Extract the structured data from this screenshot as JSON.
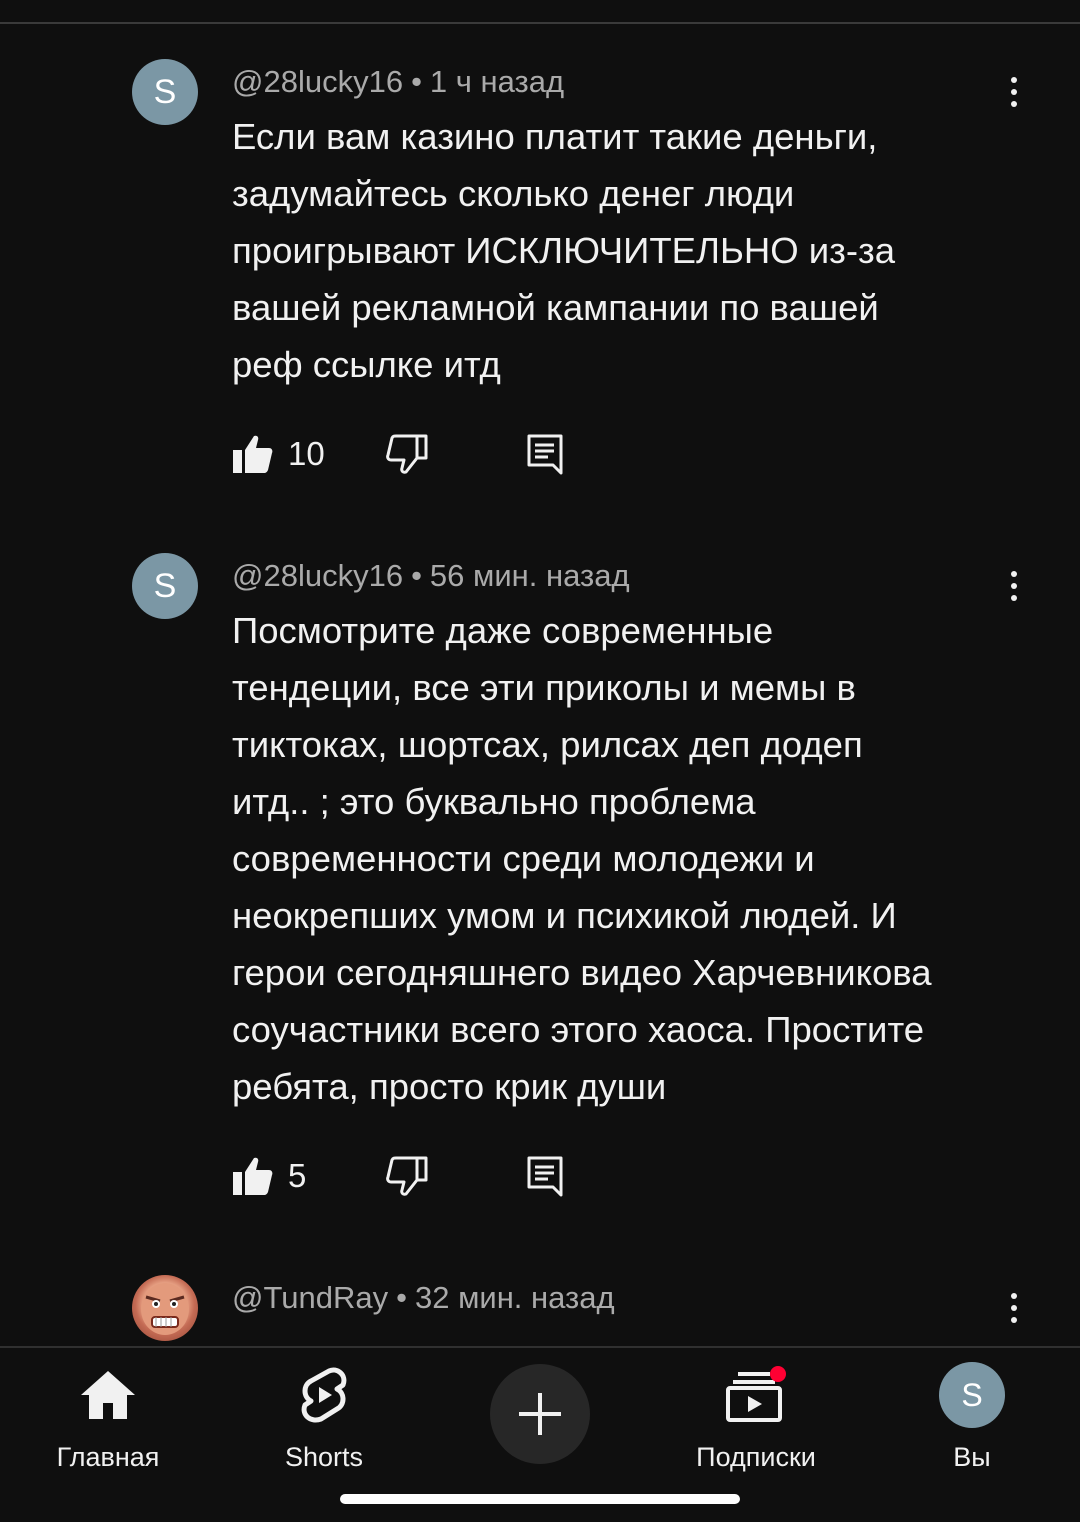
{
  "comments": [
    {
      "avatar_letter": "S",
      "author": "@28lucky16",
      "time": "1 ч назад",
      "text": "Если вам казино платит такие деньги,\nзадумайтесь сколько денег люди\nпроигрывают ИСКЛЮЧИТЕЛЬНО из-за\nвашей рекламной кампании по вашей\nреф ссылке итд",
      "likes": "10"
    },
    {
      "avatar_letter": "S",
      "author": "@28lucky16",
      "time": "56 мин. назад",
      "text": "Посмотрите даже современные\nтендеции, все эти приколы и мемы в\nтиктоках, шортсах, рилсах деп  додеп\nитд.. ; это буквально проблема\nсовременности среди молодежи и\nнеокрепших умом и психикой людей. И\nгерои сегодняшнего видео Харчевникова\nсоучастники всего этого хаоса. Простите\nребята, просто крик души",
      "likes": "5"
    },
    {
      "author": "@TundRay",
      "time": "32 мин. назад"
    }
  ],
  "meta_separator": "•",
  "nav": {
    "home": "Главная",
    "shorts": "Shorts",
    "subscriptions": "Подписки",
    "you": "Вы",
    "you_avatar_letter": "S"
  },
  "colors": {
    "background": "#0f0f0f",
    "avatar": "#7b97a5",
    "notification_dot": "#ff0033"
  }
}
